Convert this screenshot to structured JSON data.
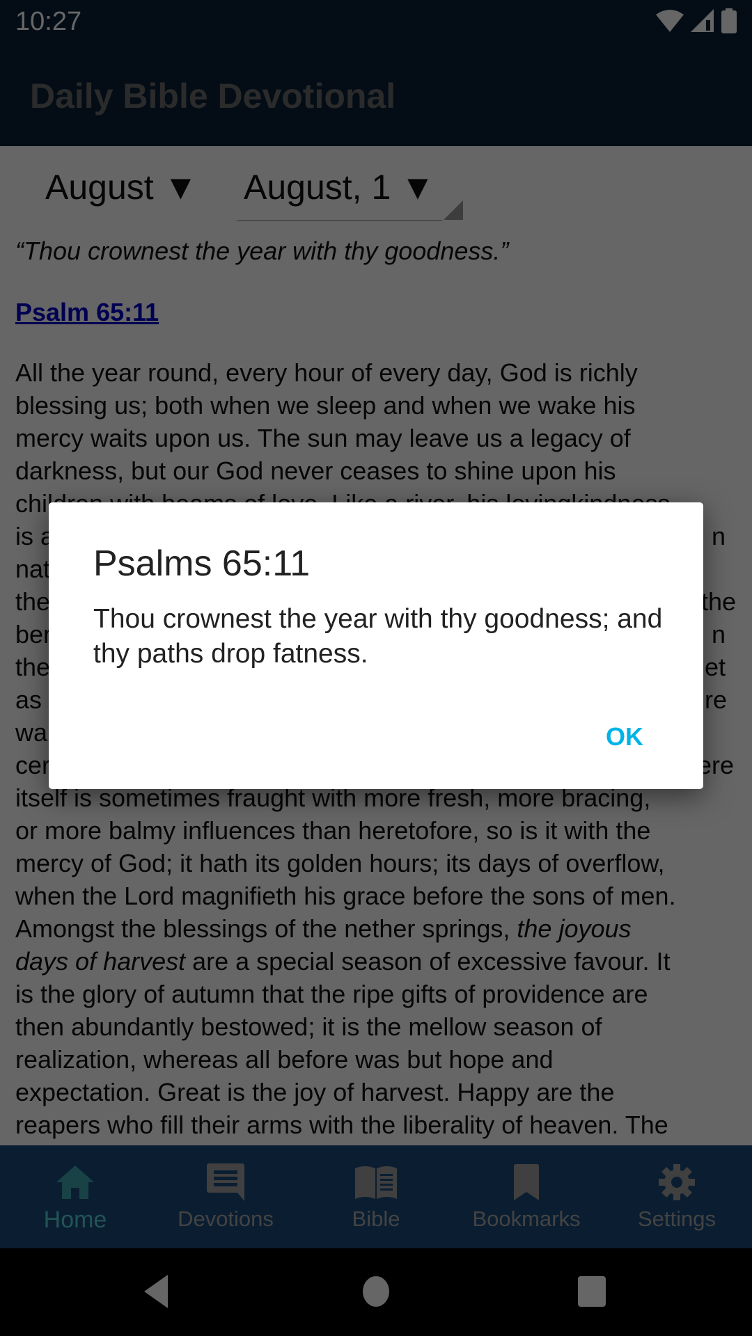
{
  "status_bar": {
    "time": "10:27",
    "icons": [
      "wifi-icon",
      "cell-signal-icon",
      "battery-icon"
    ]
  },
  "app_bar": {
    "title": "Daily Bible Devotional"
  },
  "selectors": {
    "month": {
      "value": "August",
      "arrow": "▼"
    },
    "day": {
      "value": "August, 1",
      "arrow": "▼"
    }
  },
  "devotional": {
    "quote": "“Thou crownest the year with thy goodness.”",
    "reference": "Psalm 65:11",
    "lines": [
      "All the year round, every hour of every day, God is richly",
      "blessing us; both when we sleep and when we wake his",
      "mercy waits upon us. The sun may leave us a legacy of",
      "darkness, but our God never ceases to shine upon his",
      "children with beams of love. Like a river, his lovingkindness",
      "is a",
      "nat",
      "the",
      "ber",
      "the",
      "as",
      "wa",
      "cer",
      "itself is sometimes fraught with more fresh, more bracing,",
      "or more balmy influences than heretofore, so is it with the",
      "mercy of God; it hath its golden hours; its days of overflow,",
      "when the Lord magnifieth his grace before the sons of men.",
      "Amongst the blessings of the nether springs, ",
      "days of harvest",
      " are a special season of excessive favour. It",
      "is the glory of autumn that the ripe gifts of providence are",
      "then abundantly bestowed; it is the mellow season of",
      "realization, whereas all before was but hope and",
      "expectation. Great is the joy of harvest. Happy are the",
      "reapers who fill their arms with the liberality of heaven. The"
    ],
    "italic_fragment_1": "the joyous",
    "right_fragments": [
      "n",
      "the",
      "n",
      "et",
      "re",
      "ere"
    ]
  },
  "dialog": {
    "title": "Psalms 65:11",
    "message": "Thou crownest the year with thy goodness; and thy paths drop fatness.",
    "ok_label": "OK"
  },
  "bottom_nav": {
    "items": [
      {
        "label": "Home",
        "icon": "home-icon",
        "active": true
      },
      {
        "label": "Devotions",
        "icon": "chat-icon",
        "active": false
      },
      {
        "label": "Bible",
        "icon": "book-icon",
        "active": false
      },
      {
        "label": "Bookmarks",
        "icon": "bookmark-icon",
        "active": false
      },
      {
        "label": "Settings",
        "icon": "gear-icon",
        "active": false
      }
    ]
  },
  "system_nav": {
    "buttons": [
      "back-icon",
      "home-circle-icon",
      "recents-icon"
    ]
  },
  "colors": {
    "primary": "#1d4c7c",
    "status_bar": "#0b2239",
    "accent": "#00b3e6",
    "active_tab": "#56d0d8",
    "link": "#0000cc"
  }
}
